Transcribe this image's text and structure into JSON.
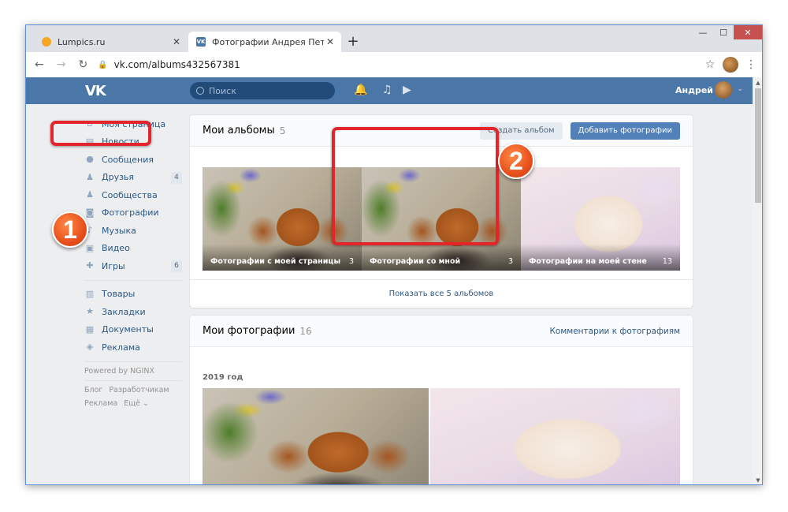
{
  "browser": {
    "tabs": [
      {
        "title": "Lumpics.ru",
        "close": "✕"
      },
      {
        "title": "Фотографии Андрея Петрова –",
        "favicon": "VK",
        "close": "✕"
      }
    ],
    "new_tab": "+",
    "window_controls": {
      "minimize": "—",
      "maximize": "☐",
      "close": "✕"
    },
    "nav": {
      "back": "←",
      "forward": "→",
      "reload": "↻",
      "star": "☆",
      "menu": "⋮"
    },
    "url": "vk.com/albums432567381"
  },
  "vk": {
    "logo": "VK",
    "search_placeholder": "Поиск",
    "user_name": "Андрей",
    "user_arrow": "⌄",
    "header_icons": {
      "bell": "🔔",
      "music": "♫",
      "video": "▶"
    }
  },
  "sidebar": {
    "main": [
      {
        "label": "Моя страница",
        "icon": "⌂"
      },
      {
        "label": "Новости",
        "icon": "▤"
      },
      {
        "label": "Сообщения",
        "icon": "●"
      },
      {
        "label": "Друзья",
        "icon": "♟",
        "badge": "4"
      },
      {
        "label": "Сообщества",
        "icon": "♟"
      },
      {
        "label": "Фотографии",
        "icon": "◙"
      },
      {
        "label": "Музыка",
        "icon": "♪"
      },
      {
        "label": "Видео",
        "icon": "▣"
      },
      {
        "label": "Игры",
        "icon": "✚",
        "badge": "6"
      }
    ],
    "secondary": [
      {
        "label": "Товары",
        "icon": "▥"
      },
      {
        "label": "Закладки",
        "icon": "★"
      },
      {
        "label": "Документы",
        "icon": "▦"
      },
      {
        "label": "Реклама",
        "icon": "◈"
      }
    ],
    "powered": "Powered by NGINX",
    "footer_links": [
      "Блог",
      "Разработчикам",
      "Реклама",
      "Ещё ⌄"
    ]
  },
  "albums": {
    "title": "Мои альбомы",
    "count": "5",
    "create_button": "Создать альбом",
    "add_button": "Добавить фотографии",
    "items": [
      {
        "name": "Фотографии с моей страницы",
        "count": "3"
      },
      {
        "name": "Фотографии со мной",
        "count": "3"
      },
      {
        "name": "Фотографии на моей стене",
        "count": "13"
      }
    ],
    "show_all": "Показать все 5 альбомов"
  },
  "photos": {
    "title": "Мои фотографии",
    "count": "16",
    "comments_link": "Комментарии к фотографиям",
    "year": "2019 год"
  },
  "callouts": [
    "1",
    "2"
  ],
  "colors": {
    "vk_blue": "#4a76a8",
    "accent_red": "#e3242b",
    "badge_orange": "#e8501d"
  }
}
